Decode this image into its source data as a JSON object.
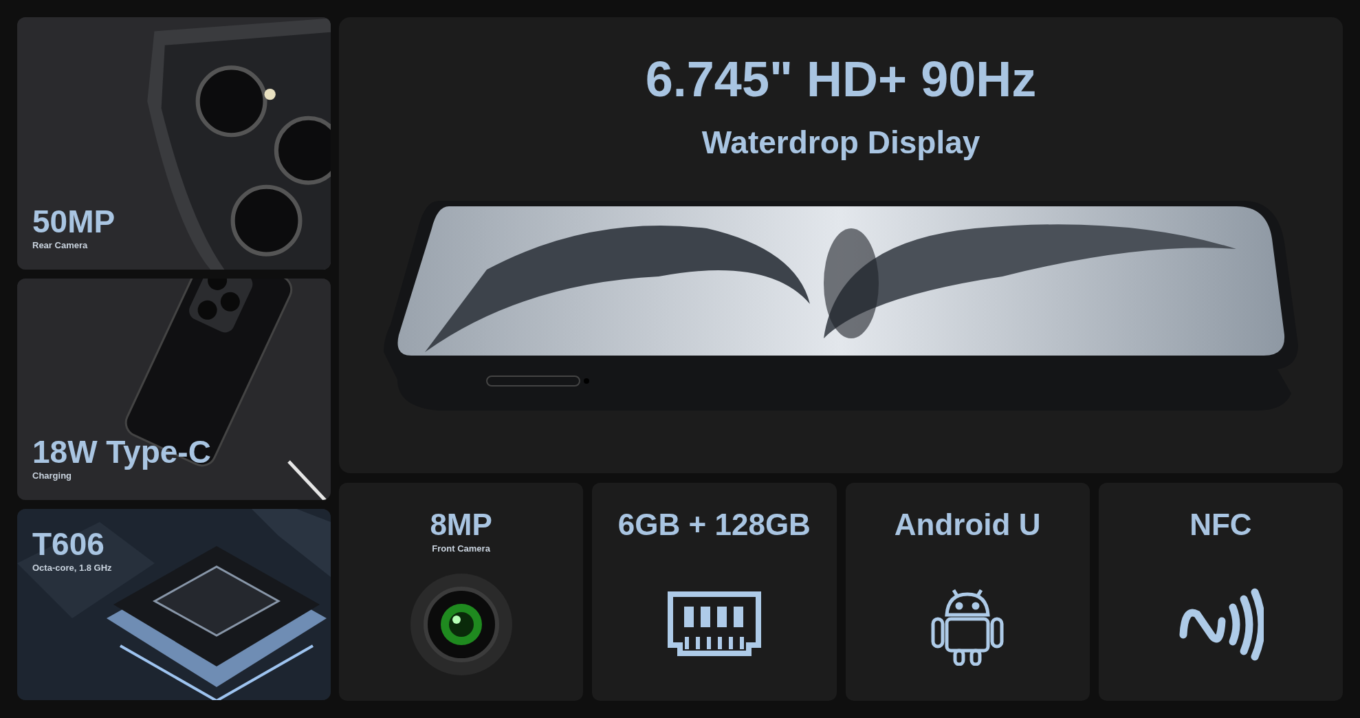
{
  "tiles": [
    {
      "kind": "camera",
      "title": "50MP",
      "subtitle": "Rear Camera"
    },
    {
      "kind": "charging",
      "title": "18W Type-C",
      "subtitle": "Charging"
    },
    {
      "kind": "chip",
      "title": "T606",
      "subtitle": "Octa-core, 1.8 GHz"
    }
  ],
  "display": {
    "title": "6.745\" HD+ 90Hz",
    "subtitle": "Waterdrop Display"
  },
  "features": [
    {
      "kind": "camera",
      "title": "8MP",
      "subtitle": "Front Camera"
    },
    {
      "kind": "memory",
      "title": "6GB + 128GB"
    },
    {
      "kind": "android",
      "title": "Android U"
    },
    {
      "kind": "nfc",
      "title": "NFC"
    }
  ]
}
